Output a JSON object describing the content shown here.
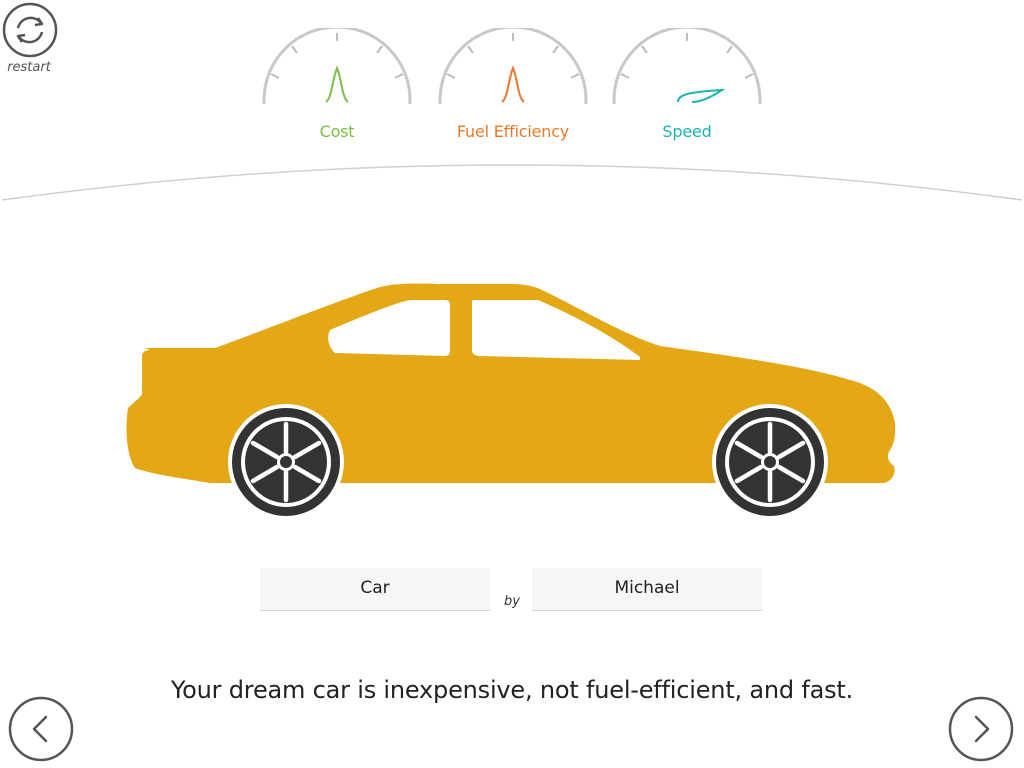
{
  "restart": {
    "label": "restart",
    "icon": "refresh-icon"
  },
  "gauges": [
    {
      "label": "Cost",
      "color": "#7bbf44",
      "level": 0.5
    },
    {
      "label": "Fuel Efficiency",
      "color": "#ea7a2a",
      "level": 0.5
    },
    {
      "label": "Speed",
      "color": "#1fb3b0",
      "level": 0.9
    }
  ],
  "car": {
    "body_color": "#e4a817",
    "wheel_color": "#333333"
  },
  "fields": {
    "car_name": "Car",
    "by_label": "by",
    "author_name": "Michael"
  },
  "summary": "Your dream car is inexpensive, not fuel-efficient, and fast.",
  "nav": {
    "prev_icon": "chevron-left-icon",
    "next_icon": "chevron-right-icon"
  }
}
